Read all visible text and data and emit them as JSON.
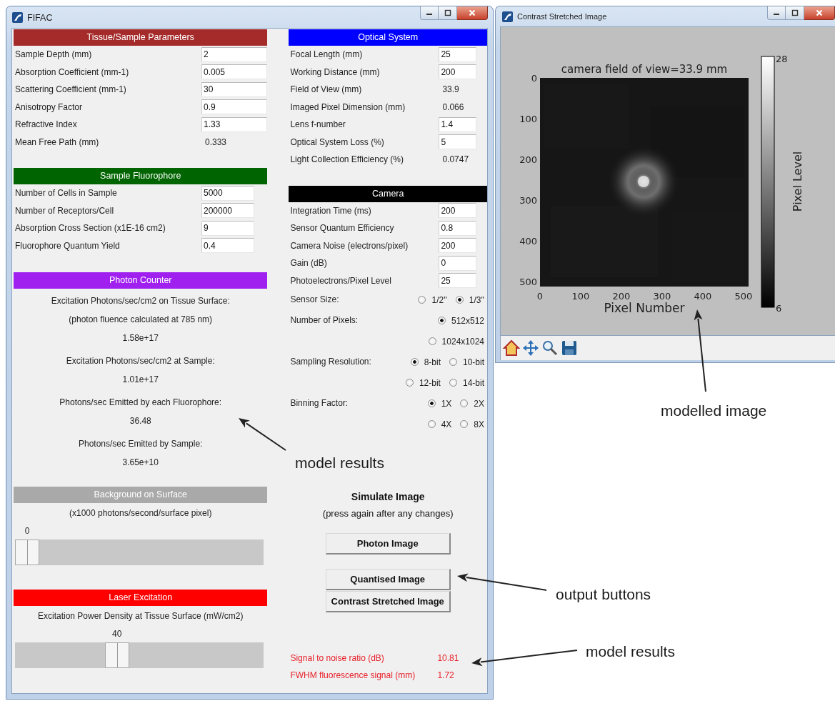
{
  "main_window": {
    "title": "FIFAC",
    "left_sections": [
      {
        "kind": "params",
        "title": "Tissue/Sample Parameters",
        "color": "#a52a2a",
        "rows": [
          {
            "kind": "input",
            "label": "Sample Depth (mm)",
            "value": "2"
          },
          {
            "kind": "input",
            "label": "Absorption Coefficient (mm-1)",
            "value": "0.005"
          },
          {
            "kind": "input",
            "label": "Scattering Coefficient (mm-1)",
            "value": "30"
          },
          {
            "kind": "input",
            "label": "Anisotropy Factor",
            "value": "0.9"
          },
          {
            "kind": "input",
            "label": "Refractive Index",
            "value": "1.33"
          },
          {
            "kind": "value",
            "label": "Mean Free Path (mm)",
            "value": "0.333"
          }
        ]
      },
      {
        "kind": "params",
        "title": "Sample Fluorophore",
        "color": "#006400",
        "rows": [
          {
            "kind": "input",
            "label": "Number of Cells in Sample",
            "value": "5000"
          },
          {
            "kind": "input",
            "label": "Number of Receptors/Cell",
            "value": "200000"
          },
          {
            "kind": "input",
            "label": "Absorption Cross Section (x1E-16 cm2)",
            "value": "9"
          },
          {
            "kind": "input",
            "label": "Fluorophore Quantum Yield",
            "value": "0.4"
          }
        ]
      },
      {
        "kind": "readout",
        "title": "Photon Counter",
        "color": "#a020f0",
        "lines": [
          {
            "kind": "caption",
            "text": "Excitation Photons/sec/cm2 on Tissue Surface:"
          },
          {
            "kind": "caption",
            "text": "(photon fluence calculated at 785 nm)"
          },
          {
            "kind": "number",
            "text": "1.58e+17"
          },
          {
            "kind": "caption",
            "text": "Excitation Photons/sec/cm2 at Sample:"
          },
          {
            "kind": "number",
            "text": "1.01e+17"
          },
          {
            "kind": "caption",
            "text": "Photons/sec Emitted by each Fluorophore:"
          },
          {
            "kind": "number",
            "text": "36.48"
          },
          {
            "kind": "caption",
            "text": "Photons/sec Emitted by Sample:"
          },
          {
            "kind": "number",
            "text": "3.65e+10"
          }
        ]
      },
      {
        "kind": "slider",
        "title": "Background on Surface",
        "color": "#a9a9a9",
        "caption": "(x1000 photons/second/surface pixel)",
        "reading": "0",
        "level": 0
      },
      {
        "kind": "slider",
        "title": "Laser Excitation",
        "color": "#ff0000",
        "caption": "Excitation Power Density at Tissue Surface (mW/cm2)",
        "reading": "40",
        "level": 0.4
      }
    ],
    "right_sections": [
      {
        "kind": "params",
        "title": "Optical System",
        "color": "#0000ff",
        "rows": [
          {
            "kind": "input",
            "label": "Focal Length (mm)",
            "value": "25"
          },
          {
            "kind": "input",
            "label": "Working Distance (mm)",
            "value": "200"
          },
          {
            "kind": "value",
            "label": "Field of View (mm)",
            "value": "33.9"
          },
          {
            "kind": "value",
            "label": "Imaged Pixel Dimension (mm)",
            "value": "0.066"
          },
          {
            "kind": "input",
            "label": "Lens f-number",
            "value": "1.4"
          },
          {
            "kind": "input",
            "label": "Optical System Loss (%)",
            "value": "5"
          },
          {
            "kind": "value",
            "label": "Light Collection Efficiency (%)",
            "value": "0.0747"
          }
        ]
      },
      {
        "kind": "params",
        "title": "Camera",
        "color": "#000000",
        "rows": [
          {
            "kind": "input",
            "label": "Integration Time (ms)",
            "value": "200"
          },
          {
            "kind": "input",
            "label": "Sensor Quantum Efficiency",
            "value": "0.8"
          },
          {
            "kind": "input",
            "label": "Camera Noise (electrons/pixel)",
            "value": "200"
          },
          {
            "kind": "input",
            "label": "Gain (dB)",
            "value": "0"
          },
          {
            "kind": "input",
            "label": "Photoelectrons/Pixel Level",
            "value": "25"
          },
          {
            "kind": "radio",
            "label": "Sensor Size:",
            "lines": [
              [
                {
                  "label": "1/2''",
                  "selected": false
                },
                {
                  "label": "1/3''",
                  "selected": true
                }
              ]
            ]
          },
          {
            "kind": "radio",
            "label": "Number of Pixels:",
            "lines": [
              [
                {
                  "label": "512x512",
                  "selected": true
                }
              ],
              [
                {
                  "label": "1024x1024",
                  "selected": false
                }
              ]
            ]
          },
          {
            "kind": "radio",
            "label": "Sampling Resolution:",
            "lines": [
              [
                {
                  "label": "8-bit",
                  "selected": true
                },
                {
                  "label": "10-bit",
                  "selected": false
                }
              ],
              [
                {
                  "label": "12-bit",
                  "selected": false
                },
                {
                  "label": "14-bit",
                  "selected": false
                }
              ]
            ]
          },
          {
            "kind": "radio",
            "label": "Binning Factor:",
            "lines": [
              [
                {
                  "label": "1X",
                  "selected": true
                },
                {
                  "label": "2X",
                  "selected": false
                }
              ],
              [
                {
                  "label": "4X",
                  "selected": false
                },
                {
                  "label": "8X",
                  "selected": false
                }
              ]
            ]
          }
        ]
      }
    ],
    "simulate": {
      "title": "Simulate Image",
      "subtitle": "(press again after any changes)",
      "buttons": [
        "Photon Image",
        "Quantised Image",
        "Contrast Stretched Image"
      ]
    },
    "results": [
      {
        "label": "Signal to noise ratio (dB)",
        "value": "10.81"
      },
      {
        "label": "FWHM fluorescence signal (mm)",
        "value": "1.72"
      }
    ]
  },
  "image_window": {
    "title": "Contrast Stretched Image",
    "plot": {
      "title": "camera field of view=33.9 mm",
      "xlabel": "Pixel Number",
      "xticks": [
        "0",
        "100",
        "200",
        "300",
        "400",
        "500"
      ],
      "yticks": [
        "0",
        "100",
        "200",
        "300",
        "400",
        "500"
      ],
      "colorbar_label": "Pixel Level",
      "colorbar_max": "28",
      "colorbar_min": "6"
    },
    "toolbar": [
      {
        "kind": "home"
      },
      {
        "kind": "pan"
      },
      {
        "kind": "zoom"
      },
      {
        "kind": "save"
      }
    ]
  },
  "annotations": [
    {
      "text": "modelled image"
    },
    {
      "text": "model results"
    },
    {
      "text": "output buttons"
    },
    {
      "text": "model results"
    }
  ]
}
